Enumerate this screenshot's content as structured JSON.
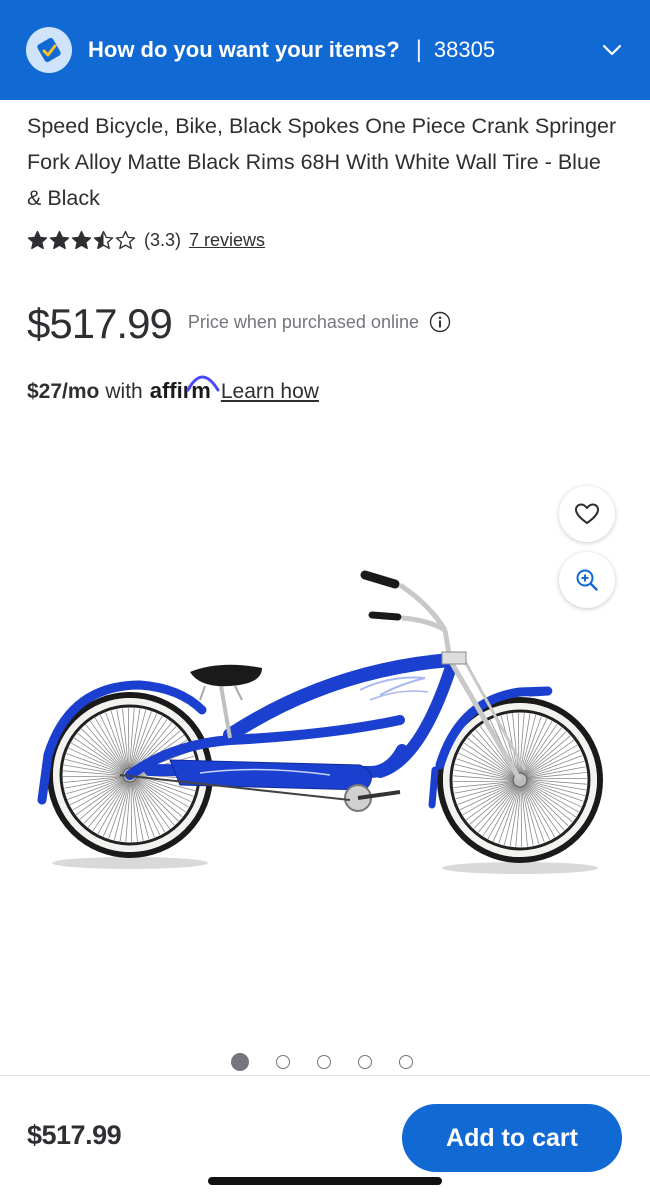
{
  "header": {
    "question": "How do you want your items?",
    "separator": "|",
    "zip": "38305",
    "icons": {
      "fulfillment": "fulfillment-intent-icon",
      "expand": "chevron-down-icon"
    }
  },
  "product": {
    "title": "Speed Bicycle, Bike, Black Spokes One Piece Crank Springer Fork Alloy Matte Black Rims 68H With White Wall Tire - Blue & Black",
    "rating": {
      "stars": 3.5,
      "value_text": "(3.3)",
      "reviews_text": "7 reviews"
    },
    "price": "$517.99",
    "price_note": "Price when purchased online",
    "affirm": {
      "monthly": "$27/mo",
      "with": "with",
      "logo": "affirm",
      "learn": "Learn how"
    },
    "image_alt": "blue stretch cruiser bicycle",
    "gallery": {
      "count": 5,
      "active_index": 0
    }
  },
  "actions": {
    "favorite_icon": "heart-icon",
    "zoom_icon": "zoom-in-icon"
  },
  "footer": {
    "price": "$517.99",
    "add_to_cart": "Add to cart"
  },
  "colors": {
    "brand_blue": "#1169d4",
    "text": "#2e2f32",
    "muted": "#74767c",
    "bike_blue": "#1b3fcf"
  }
}
